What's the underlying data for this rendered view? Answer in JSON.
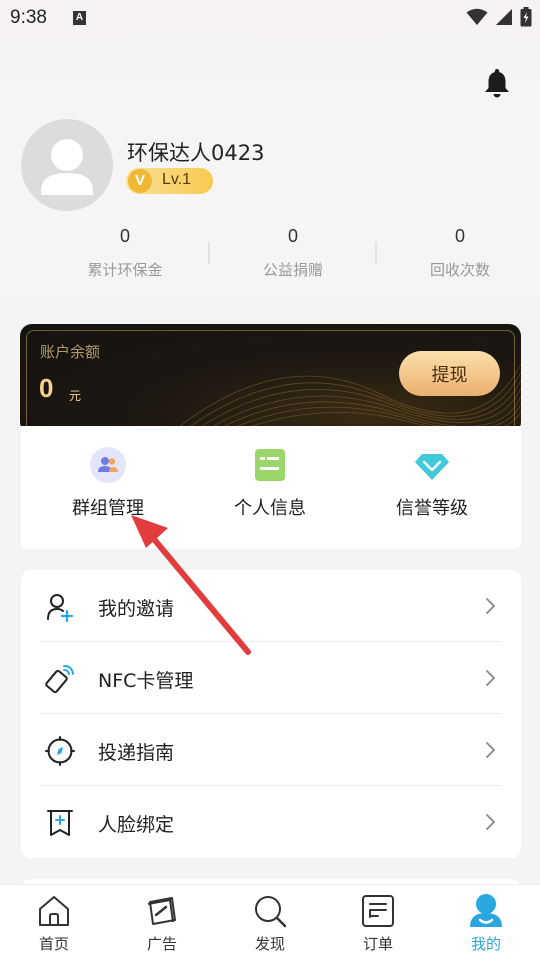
{
  "status_bar": {
    "time": "9:38",
    "indicator": "A"
  },
  "profile": {
    "username": "环保达人0423",
    "level_icon": "V",
    "level": "Lv.1"
  },
  "stats": [
    {
      "value": "0",
      "label": "累计环保金"
    },
    {
      "value": "0",
      "label": "公益捐赠"
    },
    {
      "value": "0",
      "label": "回收次数"
    }
  ],
  "balance": {
    "label": "账户余额",
    "amount": "0",
    "unit": "元",
    "withdraw_label": "提现"
  },
  "quick_actions": [
    {
      "label": "群组管理",
      "icon": "group-icon"
    },
    {
      "label": "个人信息",
      "icon": "id-card-icon"
    },
    {
      "label": "信誉等级",
      "icon": "diamond-icon"
    }
  ],
  "menu": [
    {
      "label": "我的邀请",
      "icon": "invite-user-icon"
    },
    {
      "label": "NFC卡管理",
      "icon": "nfc-card-icon"
    },
    {
      "label": "投递指南",
      "icon": "compass-icon"
    },
    {
      "label": "人脸绑定",
      "icon": "face-bind-icon"
    }
  ],
  "nav": [
    {
      "label": "首页",
      "icon": "home-icon",
      "active": false
    },
    {
      "label": "广告",
      "icon": "ad-icon",
      "active": false
    },
    {
      "label": "发现",
      "icon": "search-icon",
      "active": false
    },
    {
      "label": "订单",
      "icon": "order-icon",
      "active": false
    },
    {
      "label": "我的",
      "icon": "profile-icon",
      "active": true
    }
  ],
  "colors": {
    "accent": "#2aa7e0",
    "gold": "#f6d28e",
    "annotation_arrow": "#e23c3c"
  }
}
